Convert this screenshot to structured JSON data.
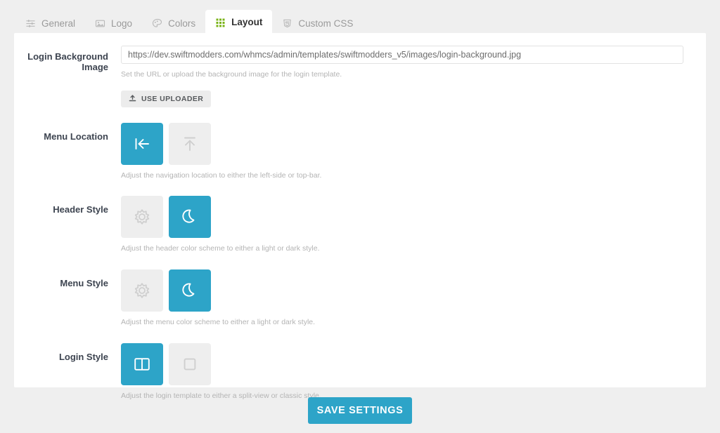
{
  "theme": {
    "accent": "#2da4c8",
    "page_bg": "#efefef",
    "card_bg": "#ffffff",
    "tile_bg": "#eeeeee",
    "label_color": "#3d4450",
    "help_color": "#b4b4b4",
    "layout_tab_icon_color": "#7ab317"
  },
  "tabs": [
    {
      "label": "General",
      "icon": "sliders-icon",
      "active": false
    },
    {
      "label": "Logo",
      "icon": "image-icon",
      "active": false
    },
    {
      "label": "Colors",
      "icon": "palette-icon",
      "active": false
    },
    {
      "label": "Layout",
      "icon": "grid-dots-icon",
      "active": true
    },
    {
      "label": "Custom CSS",
      "icon": "css3-icon",
      "active": false
    }
  ],
  "form": {
    "background_image": {
      "label": "Login Background Image",
      "value": "https://dev.swiftmodders.com/whmcs/admin/templates/swiftmodders_v5/images/login-background.jpg",
      "placeholder": "https://dev.swiftmodders.com/whmcs/admin/templates/swiftmodders_v5/images/login-background.jpg",
      "help": "Set the URL or upload the background image for the login template.",
      "uploader_button": "USE UPLOADER",
      "uploader_icon": "upload-icon"
    },
    "menu_location": {
      "label": "Menu Location",
      "help": "Adjust the navigation location to either the left-side or top-bar.",
      "options": [
        {
          "name": "left-side",
          "icon": "arrow-to-left-icon",
          "selected": true
        },
        {
          "name": "top-bar",
          "icon": "arrow-to-top-icon",
          "selected": false
        }
      ]
    },
    "header_style": {
      "label": "Header Style",
      "help": "Adjust the header color scheme to either a light or dark style.",
      "options": [
        {
          "name": "light",
          "icon": "sun-icon",
          "selected": false
        },
        {
          "name": "dark",
          "icon": "moon-icon",
          "selected": true
        }
      ]
    },
    "menu_style": {
      "label": "Menu Style",
      "help": "Adjust the menu color scheme to either a light or dark style.",
      "options": [
        {
          "name": "light",
          "icon": "sun-icon",
          "selected": false
        },
        {
          "name": "dark",
          "icon": "moon-icon",
          "selected": true
        }
      ]
    },
    "login_style": {
      "label": "Login Style",
      "help": "Adjust the login template to either a split-view or classic style.",
      "options": [
        {
          "name": "split-view",
          "icon": "columns-icon",
          "selected": true
        },
        {
          "name": "classic",
          "icon": "square-icon",
          "selected": false
        }
      ]
    }
  },
  "footer": {
    "save_label": "SAVE SETTINGS"
  }
}
